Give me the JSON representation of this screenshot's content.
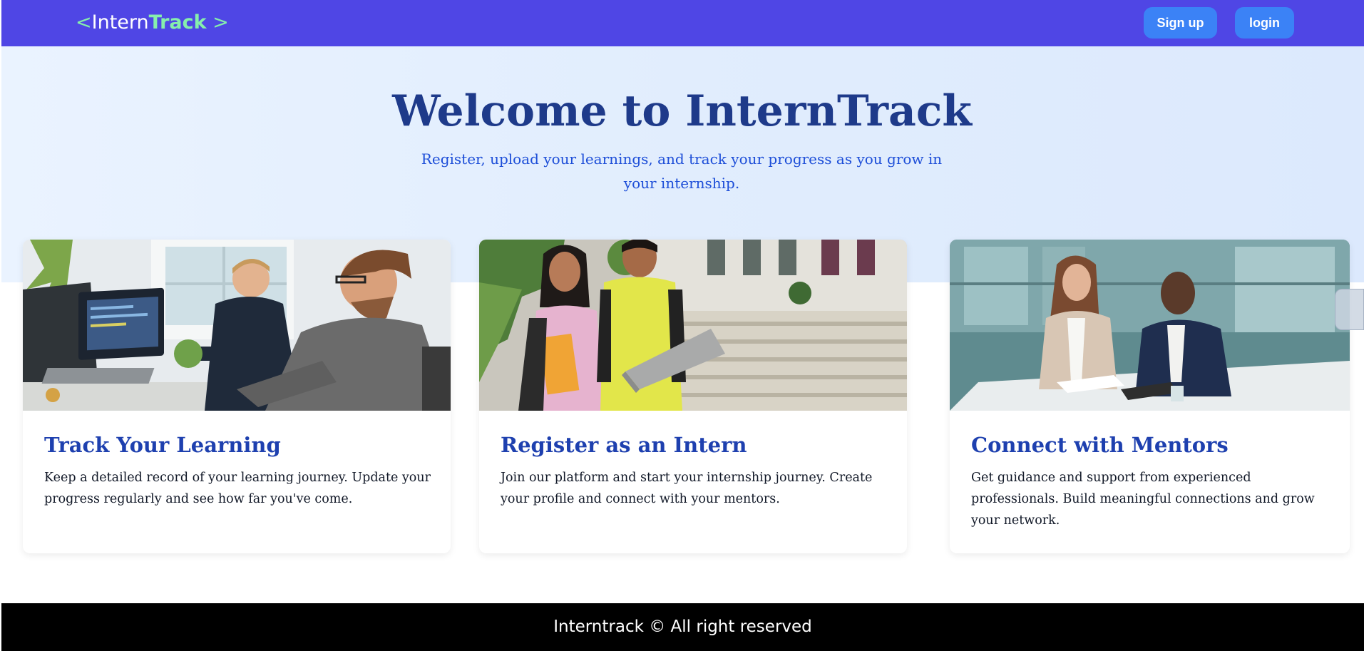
{
  "navbar": {
    "logo": {
      "open": "<",
      "intern": "Intern",
      "track": "Track",
      "close": " >"
    },
    "signup_label": "Sign up",
    "login_label": "login"
  },
  "hero": {
    "title": "Welcome to InternTrack",
    "subtitle": "Register, upload your learnings, and track your progress as you grow in your internship."
  },
  "cards": [
    {
      "title": "Track Your Learning",
      "text": "Keep a detailed record of your learning journey. Update your progress regularly and see how far you've come.",
      "image": "developers-at-computers-photo"
    },
    {
      "title": "Register as an Intern",
      "text": "Join our platform and start your internship journey. Create your profile and connect with your mentors.",
      "image": "students-with-laptop-photo"
    },
    {
      "title": "Connect with Mentors",
      "text": "Get guidance and support from experienced professionals. Build meaningful connections and grow your network.",
      "image": "mentor-meeting-photo"
    }
  ],
  "footer": {
    "text": "Interntrack © All right reserved"
  },
  "colors": {
    "navbar": "#4f46e5",
    "button": "#3b82f6",
    "logo_accent": "#86efac",
    "heading": "#1e3a8a",
    "card_title": "#1e40af",
    "footer": "#000000"
  }
}
